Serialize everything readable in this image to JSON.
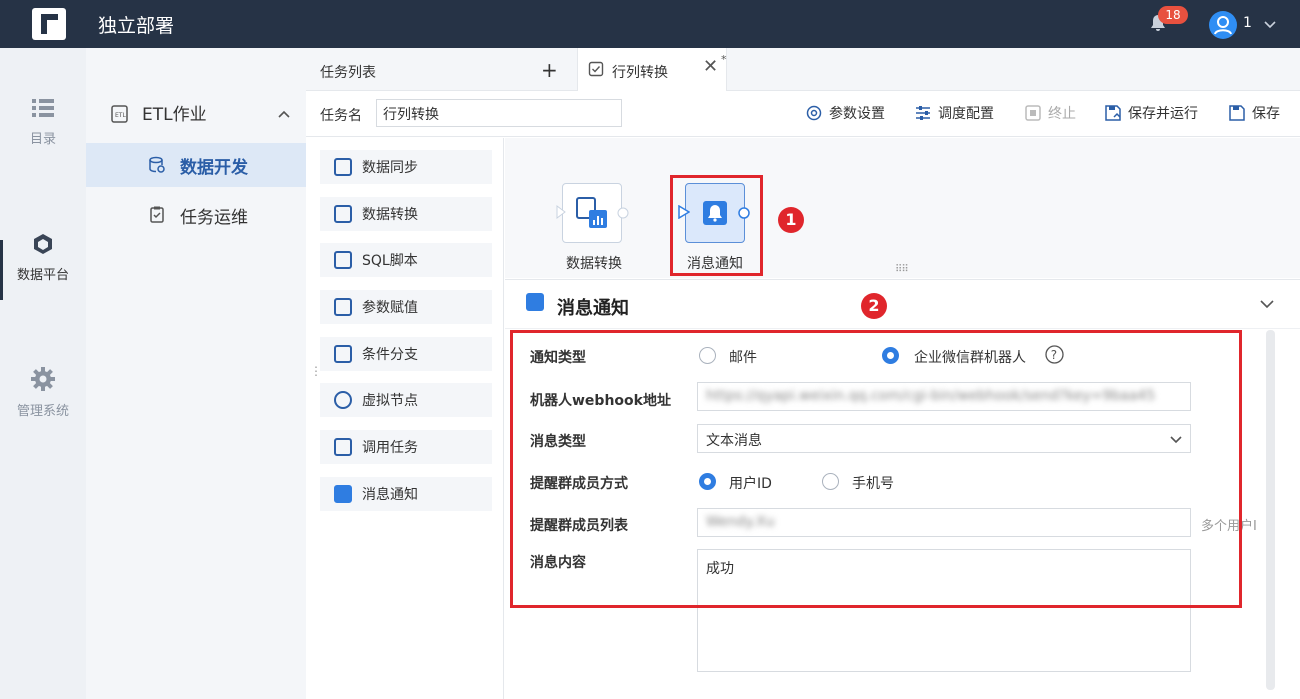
{
  "header": {
    "app_title": "独立部署",
    "notification_count": "18",
    "user_name": "1"
  },
  "rail": {
    "items": [
      {
        "label": "目录"
      },
      {
        "label": "数据平台"
      },
      {
        "label": "管理系统"
      }
    ]
  },
  "menu": {
    "section": "ETL作业",
    "items": [
      {
        "label": "数据开发"
      },
      {
        "label": "任务运维"
      }
    ]
  },
  "tabs": {
    "task_list": "任务列表",
    "current": "行列转换",
    "modified_mark": "*"
  },
  "toolbar": {
    "task_name_label": "任务名",
    "task_name_value": "行列转换",
    "params": "参数设置",
    "schedule": "调度配置",
    "stop": "终止",
    "save_run": "保存并运行",
    "save": "保存"
  },
  "node_list": [
    "数据同步",
    "数据转换",
    "SQL脚本",
    "参数赋值",
    "条件分支",
    "虚拟节点",
    "调用任务",
    "消息通知"
  ],
  "canvas": {
    "node1": "数据转换",
    "node2": "消息通知",
    "marker1": "1",
    "marker2": "2"
  },
  "detail": {
    "title": "消息通知",
    "notify_type_label": "通知类型",
    "opt_email": "邮件",
    "opt_wecom": "企业微信群机器人",
    "webhook_label": "机器人webhook地址",
    "webhook_value": "https://qyapi.weixin.qq.com/cgi-bin/webhook/send?key=9baa45",
    "msg_type_label": "消息类型",
    "msg_type_value": "文本消息",
    "mention_mode_label": "提醒群成员方式",
    "opt_userid": "用户ID",
    "opt_phone": "手机号",
    "mention_list_label": "提醒群成员列表",
    "mention_list_value": "Wendy.Xu",
    "mention_hint": "多个用户I",
    "content_label": "消息内容",
    "content_value": "成功"
  },
  "colors": {
    "topbar": "#263346",
    "accent": "#2f7de1",
    "highlight": "#e0262c"
  }
}
